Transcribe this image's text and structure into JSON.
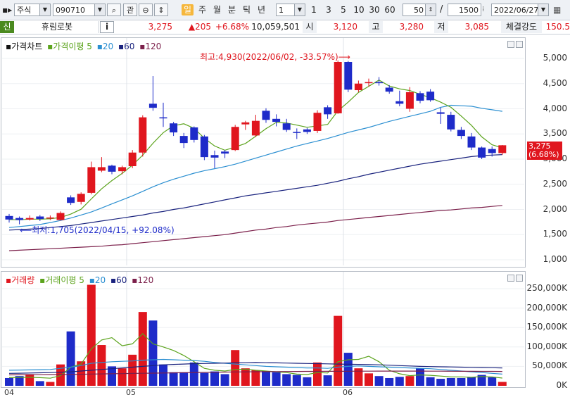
{
  "toolbar": {
    "market": "주식",
    "code": "090710",
    "buttons": {
      "search": "⌕",
      "watch": "관",
      "hide": "⊖",
      "updown": "⇕"
    },
    "periods": [
      "일",
      "주",
      "월",
      "분",
      "틱",
      "년"
    ],
    "active_period": "일",
    "unit_value": "1",
    "quick_counts": [
      "1",
      "3",
      "5",
      "10",
      "30",
      "60"
    ],
    "display_count": "50",
    "separator": "/",
    "total_count": "1500",
    "date": "2022/06/27"
  },
  "info": {
    "credit_tag": "신",
    "name": "휴림로봇",
    "info_button": "i",
    "price": "3,275",
    "change": "▲205",
    "change_pct": "+6.68%",
    "volume": "10,059,501",
    "open_label": "시",
    "open": "3,120",
    "high_label": "고",
    "high": "3,280",
    "low_label": "저",
    "low": "3,085",
    "strength_label": "체결강도",
    "strength": "150.5"
  },
  "colors": {
    "up": "#e0161e",
    "down": "#1e2bc9",
    "ma5": "#5ba31c",
    "ma20": "#2b8fd1",
    "ma60": "#1a237e",
    "ma120": "#7b1f4a",
    "vol_up": "#e0161e",
    "vol_down": "#1e2bc9"
  },
  "chart_data": [
    {
      "type": "candlestick",
      "title": "가격차트",
      "legend": [
        "가격차트",
        "가격이평 5",
        "20",
        "60",
        "120"
      ],
      "x_labels": [
        "04",
        "05",
        "06"
      ],
      "y_ticks": [
        "5,000",
        "4,500",
        "4,000",
        "3,500",
        "3,000",
        "2,500",
        "2,000",
        "1,500",
        "1,000"
      ],
      "ylim": [
        900,
        5100
      ],
      "annotations": {
        "high": "최고:4,930(2022/06/02, -33.57%)",
        "low": "최저:1,705(2022/04/15, +92.08%)",
        "last_price": "3,275",
        "last_pct": "(6.68%)"
      },
      "candles": [
        {
          "o": 1870,
          "c": 1800,
          "h": 1910,
          "l": 1740
        },
        {
          "o": 1830,
          "c": 1790,
          "h": 1860,
          "l": 1705
        },
        {
          "o": 1800,
          "c": 1830,
          "h": 1880,
          "l": 1780
        },
        {
          "o": 1860,
          "c": 1810,
          "h": 1890,
          "l": 1770
        },
        {
          "o": 1820,
          "c": 1840,
          "h": 1880,
          "l": 1790
        },
        {
          "o": 1790,
          "c": 1930,
          "h": 1960,
          "l": 1780
        },
        {
          "o": 2240,
          "c": 2130,
          "h": 2280,
          "l": 2090
        },
        {
          "o": 2150,
          "c": 2310,
          "h": 2340,
          "l": 2100
        },
        {
          "o": 2330,
          "c": 2840,
          "h": 2950,
          "l": 2300
        },
        {
          "o": 2770,
          "c": 2840,
          "h": 3040,
          "l": 2740
        },
        {
          "o": 2870,
          "c": 2750,
          "h": 2890,
          "l": 2700
        },
        {
          "o": 2760,
          "c": 2840,
          "h": 2870,
          "l": 2700
        },
        {
          "o": 2860,
          "c": 3130,
          "h": 3180,
          "l": 2820
        },
        {
          "o": 3130,
          "c": 3830,
          "h": 3870,
          "l": 3050
        },
        {
          "o": 4100,
          "c": 4020,
          "h": 4650,
          "l": 3960
        },
        {
          "o": 3830,
          "c": 3810,
          "h": 4120,
          "l": 3640
        },
        {
          "o": 3710,
          "c": 3530,
          "h": 3740,
          "l": 3460
        },
        {
          "o": 3460,
          "c": 3320,
          "h": 3520,
          "l": 3220
        },
        {
          "o": 3630,
          "c": 3380,
          "h": 3650,
          "l": 3330
        },
        {
          "o": 3450,
          "c": 3040,
          "h": 3480,
          "l": 2980
        },
        {
          "o": 3080,
          "c": 3030,
          "h": 3170,
          "l": 2820
        },
        {
          "o": 3150,
          "c": 3110,
          "h": 3180,
          "l": 3020
        },
        {
          "o": 3180,
          "c": 3640,
          "h": 3680,
          "l": 3160
        },
        {
          "o": 3690,
          "c": 3730,
          "h": 3760,
          "l": 3580
        },
        {
          "o": 3470,
          "c": 3760,
          "h": 3880,
          "l": 3440
        },
        {
          "o": 3960,
          "c": 3780,
          "h": 4010,
          "l": 3720
        },
        {
          "o": 3800,
          "c": 3740,
          "h": 3890,
          "l": 3650
        },
        {
          "o": 3710,
          "c": 3580,
          "h": 3800,
          "l": 3540
        },
        {
          "o": 3540,
          "c": 3520,
          "h": 3610,
          "l": 3400
        },
        {
          "o": 3590,
          "c": 3540,
          "h": 3620,
          "l": 3500
        },
        {
          "o": 3560,
          "c": 3920,
          "h": 3970,
          "l": 3520
        },
        {
          "o": 4030,
          "c": 3890,
          "h": 4070,
          "l": 3800
        },
        {
          "o": 3910,
          "c": 4930,
          "h": 4960,
          "l": 3900
        },
        {
          "o": 4930,
          "c": 4380,
          "h": 4950,
          "l": 4330
        },
        {
          "o": 4370,
          "c": 4500,
          "h": 4560,
          "l": 4330
        },
        {
          "o": 4510,
          "c": 4530,
          "h": 4600,
          "l": 4440
        },
        {
          "o": 4530,
          "c": 4510,
          "h": 4630,
          "l": 4460
        },
        {
          "o": 4420,
          "c": 4340,
          "h": 4470,
          "l": 4300
        },
        {
          "o": 4150,
          "c": 4100,
          "h": 4360,
          "l": 4050
        },
        {
          "o": 4000,
          "c": 4330,
          "h": 4430,
          "l": 3940
        },
        {
          "o": 4310,
          "c": 4160,
          "h": 4350,
          "l": 4110
        },
        {
          "o": 4340,
          "c": 4170,
          "h": 4390,
          "l": 4140
        },
        {
          "o": 3930,
          "c": 3900,
          "h": 4020,
          "l": 3700
        },
        {
          "o": 3880,
          "c": 3590,
          "h": 3940,
          "l": 3550
        },
        {
          "o": 3580,
          "c": 3460,
          "h": 3640,
          "l": 3400
        },
        {
          "o": 3450,
          "c": 3230,
          "h": 3520,
          "l": 3180
        },
        {
          "o": 3230,
          "c": 3030,
          "h": 3250,
          "l": 3000
        },
        {
          "o": 3200,
          "c": 3120,
          "h": 3250,
          "l": 3050
        },
        {
          "o": 3120,
          "c": 3275,
          "h": 3280,
          "l": 3085
        }
      ],
      "ma_series": [
        {
          "name": "20",
          "values": [
            1640,
            1660,
            1680,
            1700,
            1740,
            1780,
            1830,
            1890,
            1950,
            2030,
            2110,
            2190,
            2270,
            2360,
            2450,
            2530,
            2600,
            2660,
            2720,
            2770,
            2810,
            2850,
            2900,
            2960,
            3020,
            3080,
            3140,
            3200,
            3260,
            3310,
            3360,
            3410,
            3470,
            3530,
            3580,
            3630,
            3690,
            3750,
            3800,
            3850,
            3900,
            3950,
            4030,
            4070,
            4060,
            4050,
            4010,
            3980,
            3950
          ]
        },
        {
          "name": "60",
          "values": [
            1590,
            1600,
            1610,
            1620,
            1640,
            1660,
            1680,
            1710,
            1740,
            1770,
            1800,
            1830,
            1860,
            1890,
            1930,
            1960,
            2000,
            2030,
            2070,
            2110,
            2150,
            2190,
            2230,
            2270,
            2300,
            2330,
            2360,
            2390,
            2420,
            2450,
            2480,
            2520,
            2560,
            2610,
            2650,
            2700,
            2740,
            2780,
            2820,
            2860,
            2900,
            2930,
            2960,
            2990,
            3020,
            3050,
            3070,
            3080,
            3090
          ]
        },
        {
          "name": "120",
          "values": [
            1180,
            1190,
            1200,
            1210,
            1220,
            1230,
            1240,
            1250,
            1260,
            1270,
            1290,
            1300,
            1320,
            1340,
            1360,
            1380,
            1400,
            1420,
            1440,
            1460,
            1480,
            1500,
            1530,
            1560,
            1590,
            1610,
            1640,
            1660,
            1690,
            1710,
            1730,
            1750,
            1780,
            1800,
            1820,
            1840,
            1860,
            1880,
            1900,
            1920,
            1940,
            1960,
            1980,
            1990,
            2010,
            2030,
            2040,
            2060,
            2080
          ]
        }
      ]
    },
    {
      "type": "bar",
      "title": "거래량",
      "legend": [
        "거래량",
        "거래이평 5",
        "20",
        "60",
        "120"
      ],
      "y_ticks": [
        "250,000K",
        "200,000K",
        "150,000K",
        "100,000K",
        "50,000K",
        "0K"
      ],
      "ylim": [
        0,
        270000
      ],
      "values": [
        20000,
        25000,
        30000,
        12000,
        10000,
        55000,
        140000,
        63000,
        260000,
        105000,
        50000,
        45000,
        80000,
        190000,
        168000,
        55000,
        35000,
        35000,
        60000,
        33000,
        37000,
        30000,
        92000,
        45000,
        40000,
        38000,
        35000,
        30000,
        28000,
        22000,
        60000,
        27000,
        180000,
        85000,
        45000,
        32000,
        25000,
        20000,
        23000,
        25000,
        45000,
        22000,
        18000,
        20000,
        20000,
        22000,
        28000,
        22000,
        10059
      ],
      "ma_series": [
        {
          "name": "거래이평 5",
          "values": [
            21000,
            21500,
            22000,
            21000,
            19500,
            26000,
            48000,
            56000,
            95000,
            118000,
            124000,
            103000,
            108000,
            134000,
            108000,
            100000,
            91000,
            78000,
            62000,
            45000,
            40000,
            38000,
            42000,
            43000,
            40000,
            38000,
            36000,
            34000,
            30000,
            29000,
            34000,
            33000,
            62000,
            67000,
            68000,
            76000,
            62000,
            40000,
            31000,
            26000,
            28000,
            27000,
            25000,
            23000,
            23000,
            22000,
            24000,
            23000,
            20000
          ]
        },
        {
          "name": "20",
          "values": [
            40000,
            40500,
            41000,
            41500,
            42000,
            45000,
            48000,
            52000,
            58000,
            60000,
            62000,
            63000,
            64000,
            66000,
            67000,
            68000,
            67000,
            66000,
            65000,
            63000,
            60000,
            58000,
            56000,
            54000,
            52000,
            50000,
            49000,
            48000,
            47000,
            46000,
            46000,
            45000,
            48000,
            50000,
            51000,
            50000,
            49000,
            48000,
            47000,
            46000,
            45000,
            44000,
            42000,
            40000,
            38000,
            36000,
            34000,
            32000,
            30000
          ]
        },
        {
          "name": "60",
          "values": [
            32000,
            32500,
            33000,
            33500,
            34000,
            35000,
            36000,
            38000,
            40000,
            42000,
            44000,
            46000,
            48000,
            50000,
            52000,
            54000,
            55000,
            56000,
            57000,
            57500,
            58000,
            58500,
            59000,
            59500,
            60000,
            59500,
            59000,
            58500,
            58000,
            57500,
            57000,
            56500,
            56000,
            55500,
            55000,
            54500,
            54000,
            53000,
            52000,
            51000,
            50000,
            49500,
            49000,
            48500,
            48000,
            47500,
            47000,
            46500,
            46000
          ]
        },
        {
          "name": "120",
          "values": [
            28000,
            28200,
            28400,
            28600,
            28800,
            29000,
            29400,
            29800,
            30200,
            30600,
            31000,
            31400,
            31800,
            32200,
            32600,
            33000,
            33400,
            33800,
            34200,
            34600,
            35000,
            35300,
            35600,
            35900,
            36200,
            36400,
            36600,
            36800,
            37000,
            37100,
            37200,
            37300,
            37400,
            37500,
            37600,
            37700,
            37800,
            37800,
            37800,
            37800,
            37800,
            37700,
            37600,
            37500,
            37400,
            37300,
            37200,
            37100,
            37000
          ]
        }
      ]
    }
  ]
}
